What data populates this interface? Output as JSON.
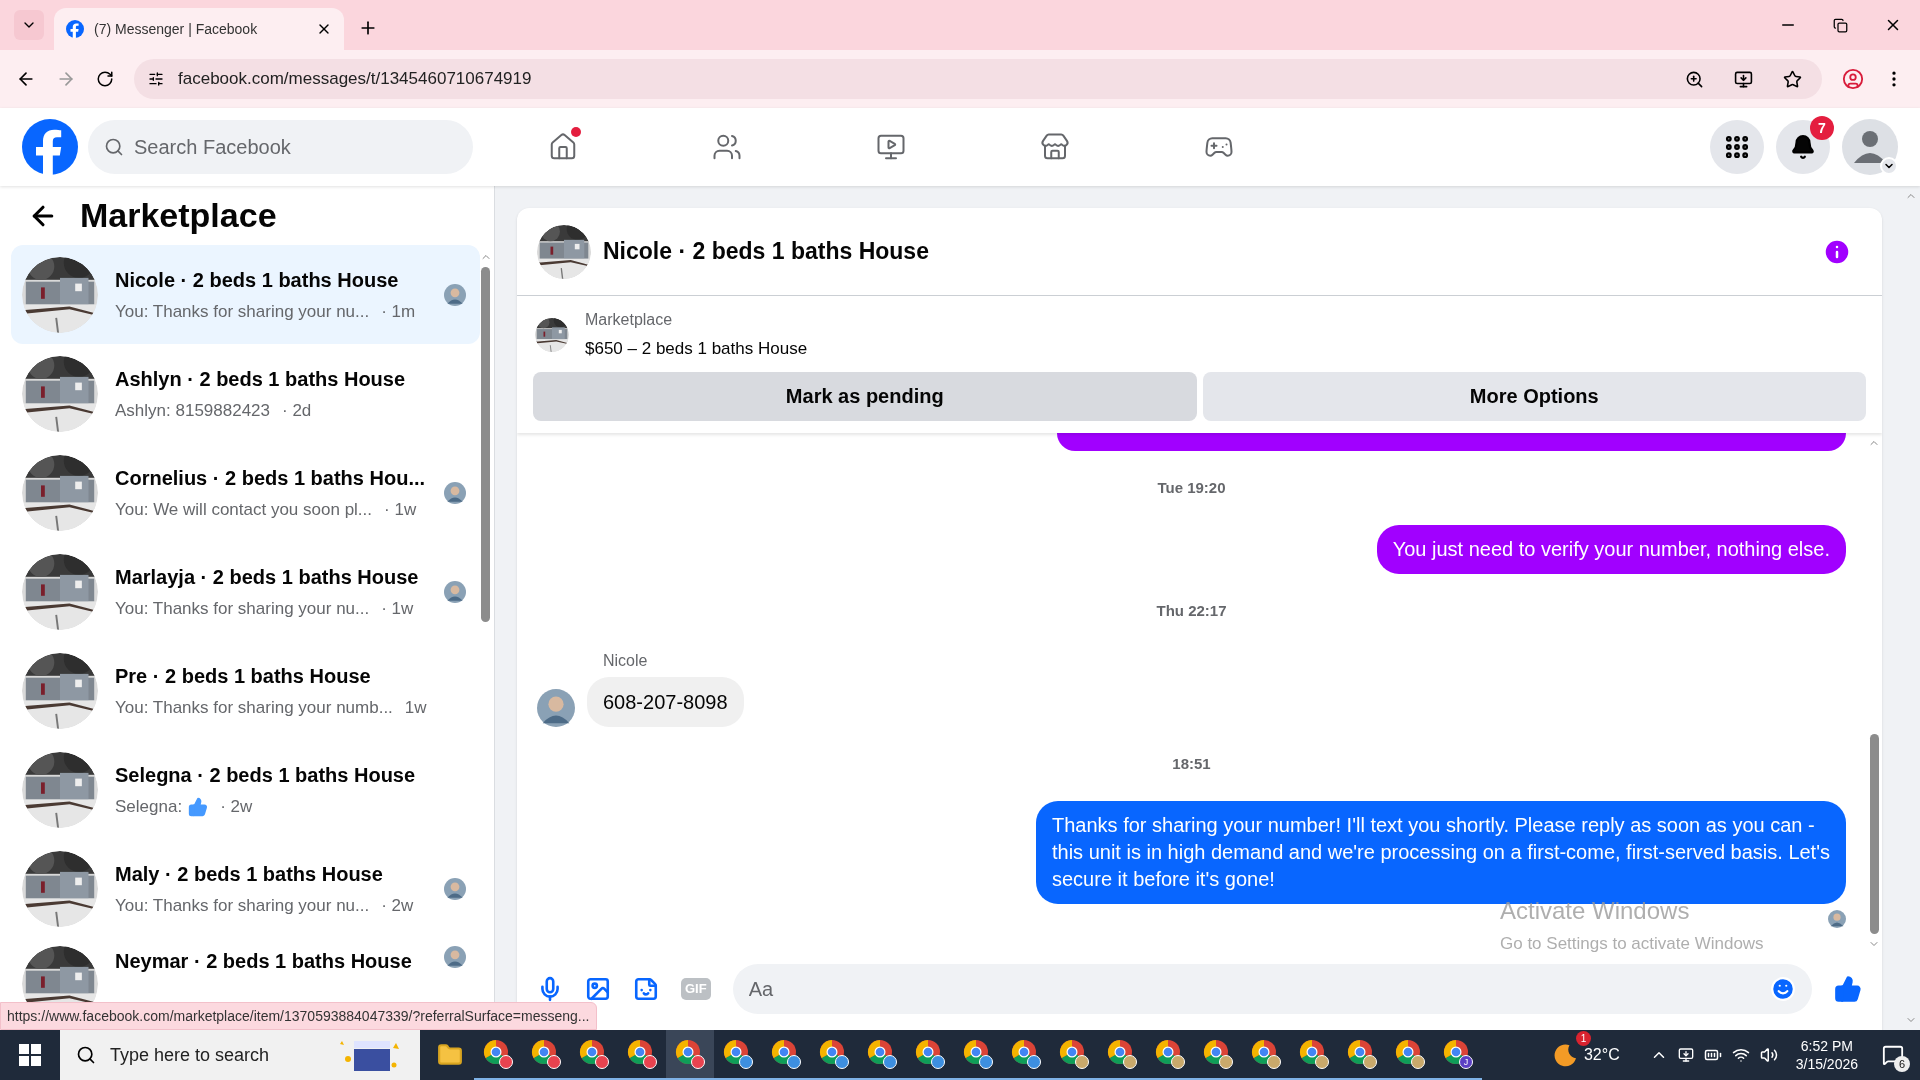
{
  "browser": {
    "tab": {
      "title": "(7) Messenger | Facebook"
    },
    "url": "facebook.com/messages/t/1345460710674919",
    "status_url": "https://www.facebook.com/marketplace/item/1370593884047339/?referralSurface=messeng..."
  },
  "header": {
    "search": {
      "placeholder": "Search Facebook"
    },
    "nav": [
      {
        "kind": "home",
        "dot": true
      },
      {
        "kind": "friends",
        "dot": false
      },
      {
        "kind": "video",
        "dot": false
      },
      {
        "kind": "marketplace",
        "dot": false
      },
      {
        "kind": "gaming",
        "dot": false
      }
    ],
    "notification_count": "7"
  },
  "sidebar": {
    "title": "Marketplace",
    "conversations": [
      {
        "title": "Nicole · 2 beds 1 baths House",
        "preview": "You: Thanks for sharing your nu...",
        "time": "· 1m",
        "selected": true,
        "seen": true,
        "kind": "text"
      },
      {
        "title": "Ashlyn · 2 beds 1 baths House",
        "preview": "Ashlyn: 8159882423",
        "time": "· 2d",
        "selected": false,
        "seen": false,
        "kind": "text"
      },
      {
        "title": "Cornelius · 2 beds 1 baths Hou...",
        "preview": "You: We will contact you soon pl...",
        "time": "· 1w",
        "selected": false,
        "seen": true,
        "kind": "text"
      },
      {
        "title": "Marlayja · 2 beds 1 baths House",
        "preview": "You: Thanks for sharing your nu...",
        "time": "· 1w",
        "selected": false,
        "seen": true,
        "kind": "text"
      },
      {
        "title": "Pre · 2 beds 1 baths House",
        "preview": "You: Thanks for sharing your numb...",
        "time": "1w",
        "selected": false,
        "seen": false,
        "kind": "text"
      },
      {
        "title": "Selegna · 2 beds 1 baths House",
        "preview": "Selegna:",
        "time": "· 2w",
        "selected": false,
        "seen": false,
        "kind": "like"
      },
      {
        "title": "Maly · 2 beds 1 baths House",
        "preview": "You: Thanks for sharing your nu...",
        "time": "· 2w",
        "selected": false,
        "seen": true,
        "kind": "text"
      },
      {
        "title": "Neymar · 2 beds 1 baths House",
        "selected": false,
        "seen": true
      }
    ]
  },
  "chat": {
    "title": "Nicole · 2 beds 1 baths House",
    "listing": {
      "label": "Marketplace",
      "title": "$650 – 2 beds 1 baths House"
    },
    "actions": [
      {
        "label": "Mark as pending",
        "selected": true
      },
      {
        "label": "More Options",
        "selected": false
      }
    ],
    "messages": [
      {
        "kind": "sent",
        "color": "#a100ff"
      },
      {
        "kind": "time",
        "text": "Tue 19:20"
      },
      {
        "kind": "sent",
        "color": "#a100ff",
        "text": "You just need to verify your number, nothing else."
      },
      {
        "kind": "time",
        "text": "Thu 22:17"
      },
      {
        "kind": "received",
        "sender": "Nicole",
        "text": "608-207-8098"
      },
      {
        "kind": "time",
        "text": "18:51"
      },
      {
        "kind": "sent",
        "color": "#0866ff",
        "text": "Thanks for sharing your number! I'll text you shortly. Please reply as soon as you can - this unit is in high demand and we're processing on a first-come, first-served basis. Let's secure it before it's gone!",
        "seen": true
      }
    ],
    "composer": {
      "placeholder": "Aa",
      "gif_label": "GIF"
    }
  },
  "activation_notice": {
    "title": "Activate Windows",
    "subtitle": "Go to Settings to activate Windows"
  },
  "taskbar": {
    "search_placeholder": "Type here to search",
    "apps": [
      {
        "color": "#e8434f",
        "active": false
      },
      {
        "color": "#e8434f",
        "active": false
      },
      {
        "color": "#e8434f",
        "active": false
      },
      {
        "color": "#e8434f",
        "active": false
      },
      {
        "color": "#e8434f",
        "active": true
      },
      {
        "color": "#3d8fe0",
        "active": false
      },
      {
        "color": "#3d8fe0",
        "active": false
      },
      {
        "color": "#3d8fe0",
        "active": false
      },
      {
        "color": "#3d8fe0",
        "active": false
      },
      {
        "color": "#3d8fe0",
        "active": false
      },
      {
        "color": "#3d8fe0",
        "active": false
      },
      {
        "color": "#3d8fe0",
        "active": false
      },
      {
        "color": "#c9a96b",
        "active": false
      },
      {
        "color": "#c9a96b",
        "active": false
      },
      {
        "color": "#c9a96b",
        "active": false
      },
      {
        "color": "#c9a96b",
        "active": false
      },
      {
        "color": "#c9a96b",
        "active": false
      },
      {
        "color": "#c9a96b",
        "active": false
      },
      {
        "color": "#c9a96b",
        "active": false
      },
      {
        "color": "#c9a96b",
        "active": false
      },
      {
        "color": "#5b3fc4",
        "active": false,
        "letter": "J"
      }
    ],
    "weather": {
      "badge": "1",
      "temperature": "32°C"
    },
    "time": "6:52 PM",
    "date": "3/15/2026",
    "notification_count": "6"
  }
}
